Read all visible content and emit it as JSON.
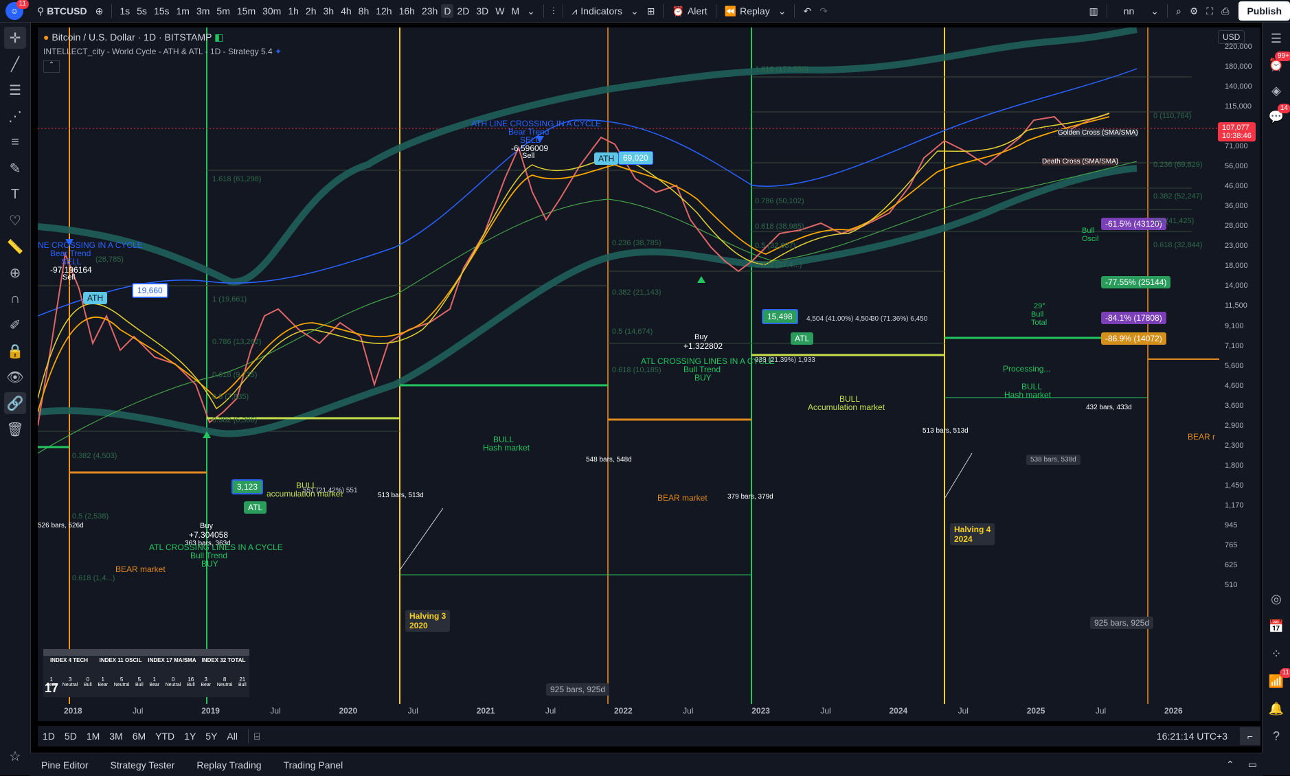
{
  "topbar": {
    "notif_count": "11",
    "symbol": "BTCUSD",
    "timeframes": [
      "1s",
      "5s",
      "15s",
      "1m",
      "3m",
      "5m",
      "15m",
      "30m",
      "1h",
      "2h",
      "3h",
      "4h",
      "8h",
      "12h",
      "16h",
      "23h",
      "D",
      "2D",
      "3D",
      "W",
      "M"
    ],
    "active_timeframe": "D",
    "indicators_label": "Indicators",
    "alert_label": "Alert",
    "replay_label": "Replay",
    "layout_name": "nn",
    "publish_label": "Publish"
  },
  "legend": {
    "title": "Bitcoin / U.S. Dollar · 1D · BITSTAMP",
    "strategy": "INTELLECT_city - World Cycle - ATH & ATL - 1D - Strategy 5.4"
  },
  "currency": "USD",
  "price_axis": [
    "220,000",
    "180,000",
    "140,000",
    "115,000",
    "91,000",
    "71,000",
    "56,000",
    "46,000",
    "36,000",
    "28,000",
    "23,000",
    "18,000",
    "14,000",
    "11,500",
    "9,100",
    "7,100",
    "5,600",
    "4,600",
    "3,600",
    "2,900",
    "2,300",
    "1,800",
    "1,450",
    "1,170",
    "945",
    "765",
    "625",
    "510"
  ],
  "current_price": {
    "value": "107,077",
    "countdown": "10:38:46",
    "color": "#f23645"
  },
  "time_axis": [
    "2018",
    "Jul",
    "2019",
    "Jul",
    "2020",
    "Jul",
    "2021",
    "Jul",
    "2022",
    "Jul",
    "2023",
    "Jul",
    "2024",
    "Jul",
    "2025",
    "Jul",
    "2026"
  ],
  "chart_labels": {
    "ath1_value": "19,660",
    "ath2_value": "69,020",
    "atl1_value": "3,123",
    "atl2_value": "15,498",
    "ath_tag": "ATH",
    "atl_tag": "ATL",
    "sell1_signal": "-97.196164",
    "sell2_signal": "-6.596009",
    "buy1_signal": "+7.304058",
    "buy2_signal": "+1.322802",
    "sell_word": "Sell",
    "buy_word": "Buy",
    "ath_crossing_1": "NE CROSSING IN A CYCLE",
    "ath_crossing_2": "ATH LINE CROSSING IN A CYCLE",
    "atl_crossing_1": "ATL CROSSING LINES IN A CYCLE",
    "atl_crossing_2": "ATL CROSSING LINES IN A CYCLE",
    "bear_trend": "Bear Trend",
    "bull_trend": "Bull Trend",
    "sell_caps": "SELL",
    "buy_caps": "BUY",
    "bull_word": "BULL",
    "hash_market": "Hash market",
    "accumulation_market": "accumulation market",
    "accumulation_market_cap": "Accumulation market",
    "bear_market": "BEAR market",
    "bear_r": "BEAR r",
    "processing": "Processing...",
    "halving3": "Halving 3",
    "halving3_year": "2020",
    "halving4": "Halving 4",
    "halving4_year": "2024",
    "golden_cross": "Golden Cross (SMA/SMA)",
    "death_cross": "Death Cross (SMA/SMA)",
    "bars_526": "526 bars, 526d",
    "bars_363": "363 bars, 363d",
    "bars_513a": "513 bars, 513d",
    "bars_548": "548 bars, 548d",
    "bars_379": "379 bars, 379d",
    "bars_513b": "513 bars, 513d",
    "bars_432": "432 bars, 433d",
    "bars_538": "538 bars, 538d",
    "bars_925a": "925 bars, 925d",
    "bars_925b": "925 bars, 925d",
    "pct_615": "-61.5% (43120)",
    "pct_7755": "-77.55% (25144)",
    "pct_841": "-84.1% (17808)",
    "pct_869": "-86.9% (14072)",
    "fib_1618_top": "1.618 (173,550)",
    "fib_0_top": "0 (110,764)",
    "fib_0236_top": "0.236 (69,629)",
    "fib_0382_top": "0.382 (52,247)",
    "fib_05_top": "0.5 (41,425)",
    "fib_0618_top": "0.618 (32,844)",
    "fib_1618_mid": "1.618 (61,298)",
    "fib_0786_mid": "0.786 (50,102)",
    "fib_0618_mid": "0.618 (38,985)",
    "fib_05_mid": "0.5 (32,687)",
    "fib_0382_mid": "0.382 (27,4...)",
    "fib_0236_c2": "0.236 (38,785)",
    "fib_0382_c2": "0.382 (21,143)",
    "fib_05_c2": "0.5 (14,674)",
    "fib_0618_c2": "0.618 (10,185)",
    "fib_1_c1": "1 (19,661)",
    "fib_0786_c1": "0.786 (13,262)",
    "fib_0618_c1": "0.618 (9,735)",
    "fib_05_c1": "0.5 (7,835)",
    "fib_0382_c1": "0.382 (6,306)",
    "fib_0382_c0": "0.382 (4,503)",
    "fib_05_c0": "0.5 (2,538)",
    "fib_0618_c0": "0.618 (1,4...)",
    "fib_28785": "(28,785)",
    "ratio_a": "4,504 (41.00%) 4,504",
    "ratio_b": "30 (71.36%) 6,450",
    "ratio_c": "933 (21.39%) 1,933",
    "ratio_d": "551 (21.42%) 551",
    "index_29": "29°",
    "bull_total": "Bull Total",
    "bull_oscil": "Bull Oscil"
  },
  "index_table": {
    "headers": [
      "INDEX 4 TECH",
      "INDEX 11 OSCIL",
      "INDEX 17 MA/SMA",
      "INDEX 32 TOTAL"
    ],
    "counts": [
      [
        "1",
        "3",
        "0"
      ],
      [
        "1",
        "5",
        "5"
      ],
      [
        "1",
        "0",
        "16"
      ],
      [
        "3",
        "8",
        "21"
      ]
    ],
    "cols": [
      "Bear",
      "Neutral",
      "Bull"
    ]
  },
  "bottom_range": [
    "1D",
    "5D",
    "1M",
    "3M",
    "6M",
    "YTD",
    "1Y",
    "5Y",
    "All"
  ],
  "clock": "16:21:14 UTC+3",
  "bottom_tabs": [
    "Pine Editor",
    "Strategy Tester",
    "Replay Trading",
    "Trading Panel"
  ],
  "right_badges": {
    "alerts": "99+",
    "messages": "14",
    "notifications": "11"
  },
  "colors": {
    "bg": "#131722",
    "halving_line": "#f5d020",
    "cycle_line": "#f7931a",
    "atl_line": "#22c55e",
    "band": "#1f5f5b",
    "ma_blue": "#2962ff",
    "ma_orange": "#f7a600",
    "ma_yellow": "#e0d030"
  }
}
